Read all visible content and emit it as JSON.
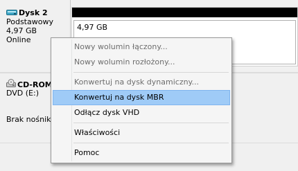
{
  "disk2": {
    "name": "Dysk 2",
    "type": "Podstawowy",
    "size": "4,97 GB",
    "status": "Online",
    "volume_size": "4,97 GB"
  },
  "cdrom": {
    "name": "CD-ROM",
    "drive": "DVD (E:)",
    "media": "Brak nośnik"
  },
  "menu": {
    "items": [
      {
        "label": "Nowy wolumin łączony...",
        "enabled": false
      },
      {
        "label": "Nowy wolumin rozłożony...",
        "enabled": false
      },
      {
        "label": "Konwertuj na dysk dynamiczny...",
        "enabled": false
      },
      {
        "label": "Konwertuj na dysk MBR",
        "enabled": true,
        "highlighted": true
      },
      {
        "label": "Odłącz dysk VHD",
        "enabled": true
      },
      {
        "label": "Właściwości",
        "enabled": true
      },
      {
        "label": "Pomoc",
        "enabled": true
      }
    ]
  },
  "colors": {
    "highlight": "#9fcbf7",
    "disabled_text": "#6d6d6d",
    "volume_header": "#000000"
  }
}
